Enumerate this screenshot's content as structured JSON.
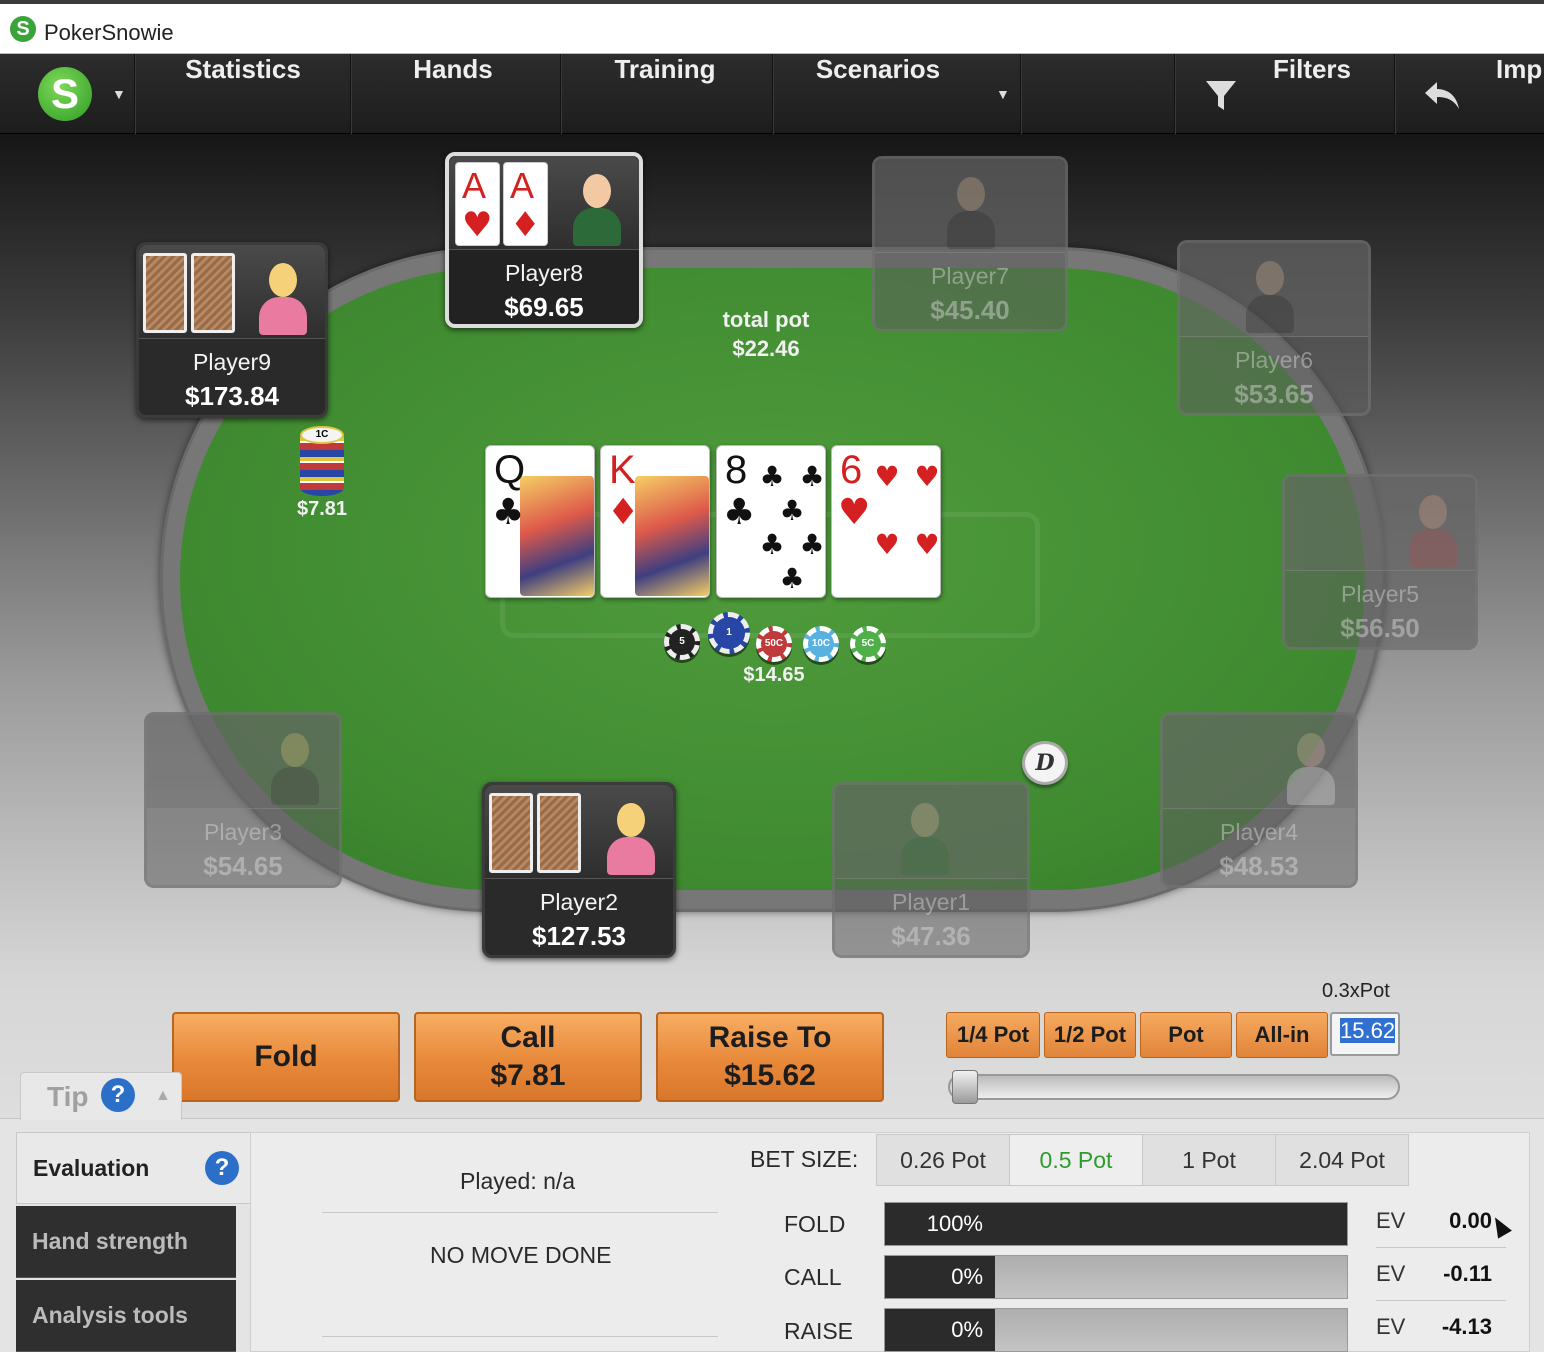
{
  "window": {
    "title": "PokerSnowie",
    "logo_letter": "S"
  },
  "menu": {
    "items": [
      "Statistics",
      "Hands",
      "Training",
      "Scenarios",
      "Filters",
      "Imp"
    ]
  },
  "table": {
    "total_pot_label": "total pot",
    "total_pot": "$22.46",
    "center_bet": "$14.65",
    "player9_bet": "$7.81",
    "board": [
      {
        "rank": "Q",
        "suit": "♣",
        "color": "black"
      },
      {
        "rank": "K",
        "suit": "♦",
        "color": "red"
      },
      {
        "rank": "8",
        "suit": "♣",
        "color": "black"
      },
      {
        "rank": "6",
        "suit": "♥",
        "color": "red"
      }
    ],
    "chips": [
      "5",
      "1",
      "50C",
      "10C",
      "5C"
    ],
    "stack_chip": "1C",
    "dealer": "D",
    "seats": {
      "player8": {
        "name": "Player8",
        "stack": "$69.65",
        "cards": [
          {
            "rank": "A",
            "suit": "♥"
          },
          {
            "rank": "A",
            "suit": "♦"
          }
        ]
      },
      "player9": {
        "name": "Player9",
        "stack": "$173.84"
      },
      "player7": {
        "name": "Player7",
        "stack": "$45.40"
      },
      "player6": {
        "name": "Player6",
        "stack": "$53.65"
      },
      "player5": {
        "name": "Player5",
        "stack": "$56.50"
      },
      "player4": {
        "name": "Player4",
        "stack": "$48.53"
      },
      "player3": {
        "name": "Player3",
        "stack": "$54.65"
      },
      "player2": {
        "name": "Player2",
        "stack": "$127.53"
      },
      "player1": {
        "name": "Player1",
        "stack": "$47.36"
      }
    }
  },
  "actions": {
    "fold": "Fold",
    "call_label": "Call",
    "call_amount": "$7.81",
    "raise_label": "Raise To",
    "raise_amount": "$15.62",
    "pot_multiple": "0.3xPot",
    "sizes": [
      "1/4 Pot",
      "1/2 Pot",
      "Pot",
      "All-in"
    ],
    "amount": "15.62",
    "slider_fraction": 0.0
  },
  "tip": {
    "label": "Tip",
    "help": "?"
  },
  "panel": {
    "tabs": [
      "Evaluation",
      "Hand strength",
      "Analysis tools"
    ],
    "played": "Played: n/a",
    "status": "NO MOVE DONE",
    "bet_size_label": "BET SIZE:",
    "bet_sizes": [
      "0.26 Pot",
      "0.5 Pot",
      "1 Pot",
      "2.04 Pot"
    ],
    "active_bet_size": "0.5 Pot",
    "moves": [
      {
        "label": "FOLD",
        "pct": "100%",
        "value": 1.0,
        "ev_label": "EV",
        "ev": "0.00"
      },
      {
        "label": "CALL",
        "pct": "0%",
        "value": 0.0,
        "ev_label": "EV",
        "ev": "-0.11"
      },
      {
        "label": "RAISE",
        "pct": "0%",
        "value": 0.0,
        "ev_label": "EV",
        "ev": "-4.13"
      }
    ]
  },
  "colors": {
    "felt": "#4f9c3c",
    "button": "#e8893a",
    "accent_green": "#2e9b2e",
    "help_blue": "#2c6fc9"
  }
}
